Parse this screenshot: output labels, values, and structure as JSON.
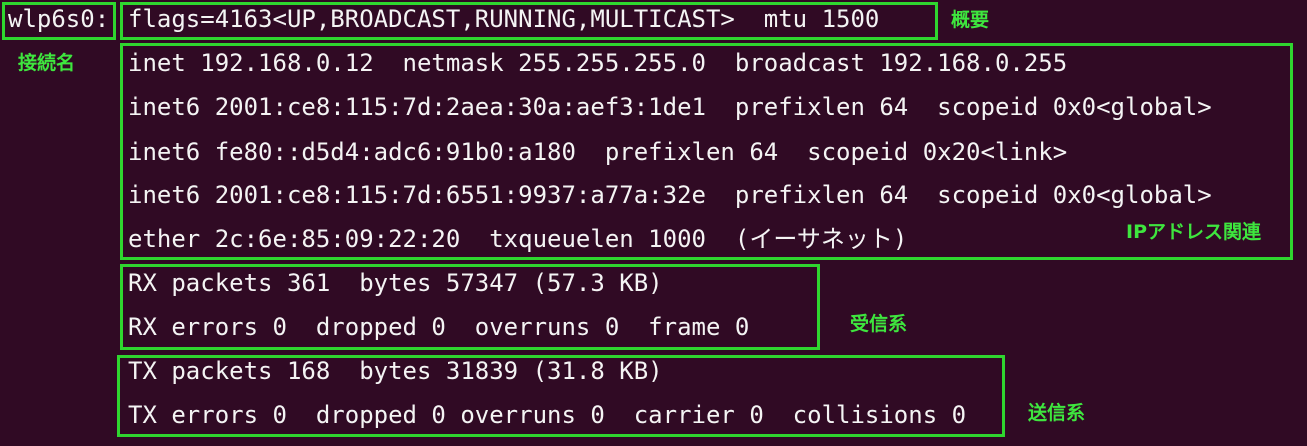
{
  "terminal": {
    "interface": "wlp6s0:",
    "summary_line": "flags=4163<UP,BROADCAST,RUNNING,MULTICAST>  mtu 1500",
    "ip_lines": [
      "inet 192.168.0.12  netmask 255.255.255.0  broadcast 192.168.0.255",
      "inet6 2001:ce8:115:7d:2aea:30a:aef3:1de1  prefixlen 64  scopeid 0x0<global>",
      "inet6 fe80::d5d4:adc6:91b0:a180  prefixlen 64  scopeid 0x20<link>",
      "inet6 2001:ce8:115:7d:6551:9937:a77a:32e  prefixlen 64  scopeid 0x0<global>",
      "ether 2c:6e:85:09:22:20  txqueuelen 1000  (イーサネット)"
    ],
    "rx_lines": [
      "RX packets 361  bytes 57347 (57.3 KB)",
      "RX errors 0  dropped 0  overruns 0  frame 0"
    ],
    "tx_lines": [
      "TX packets 168  bytes 31839 (31.8 KB)",
      "TX errors 0  dropped 0 overruns 0  carrier 0  collisions 0"
    ]
  },
  "annotations": {
    "overview": "概要",
    "connection_name": "接続名",
    "ip_related": "IPアドレス関連",
    "receive": "受信系",
    "send": "送信系"
  },
  "colors": {
    "background": "#300a24",
    "text": "#f4f4f4",
    "highlight": "#2fd62f"
  }
}
